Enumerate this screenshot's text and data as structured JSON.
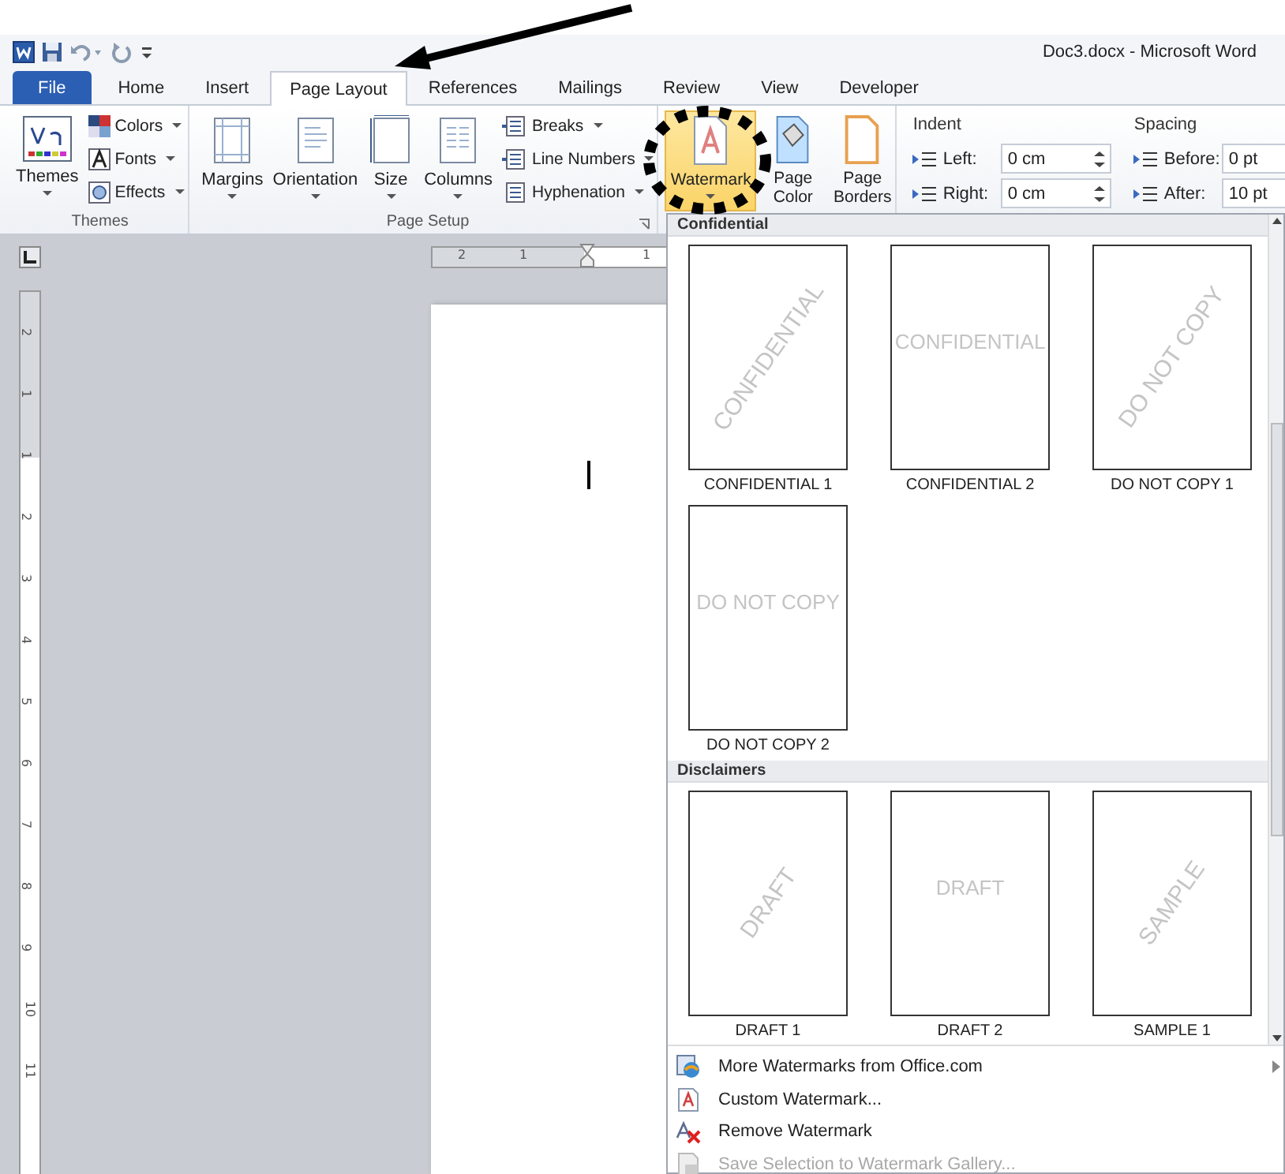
{
  "window": {
    "title": "Doc3.docx - Microsoft Word"
  },
  "tabs": [
    {
      "label": "File",
      "kind": "file",
      "selected": false
    },
    {
      "label": "Home",
      "kind": "tab",
      "selected": false
    },
    {
      "label": "Insert",
      "kind": "tab",
      "selected": false
    },
    {
      "label": "Page Layout",
      "kind": "tab",
      "selected": true
    },
    {
      "label": "References",
      "kind": "tab",
      "selected": false
    },
    {
      "label": "Mailings",
      "kind": "tab",
      "selected": false
    },
    {
      "label": "Review",
      "kind": "tab",
      "selected": false
    },
    {
      "label": "View",
      "kind": "tab",
      "selected": false
    },
    {
      "label": "Developer",
      "kind": "tab",
      "selected": false
    }
  ],
  "ribbon": {
    "themes": {
      "button": "Themes",
      "items": [
        "Colors",
        "Fonts",
        "Effects"
      ],
      "label": "Themes"
    },
    "page_setup": {
      "buttons": [
        "Margins",
        "Orientation",
        "Size",
        "Columns"
      ],
      "items": [
        "Breaks",
        "Line Numbers",
        "Hyphenation"
      ],
      "label": "Page Setup"
    },
    "page_background": [
      {
        "label": "Watermark",
        "kind": "watermark",
        "selected": true
      },
      {
        "label": "Page Color",
        "kind": "color",
        "selected": false
      },
      {
        "label": "Page Borders",
        "kind": "borders",
        "selected": false
      }
    ],
    "paragraph": [
      {
        "title": "Indent",
        "fields": [
          {
            "label": "Left:",
            "value": "0 cm"
          },
          {
            "label": "Right:",
            "value": "0 cm"
          }
        ]
      },
      {
        "title": "Spacing",
        "fields": [
          {
            "label": "Before:",
            "value": "0 pt"
          },
          {
            "label": "After:",
            "value": "10 pt"
          }
        ]
      }
    ]
  },
  "ruler": {
    "horizontal": [
      "2",
      "1",
      "1"
    ],
    "vertical": [
      "2",
      "1",
      "1",
      "2",
      "3",
      "4",
      "5",
      "6",
      "7",
      "8",
      "9",
      "10",
      "11"
    ]
  },
  "gallery": [
    {
      "title": "Confidential",
      "items": [
        {
          "label": "CONFIDENTIAL 1",
          "mark": "CONFIDENTIAL",
          "kind": "diagonal"
        },
        {
          "label": "CONFIDENTIAL 2",
          "mark": "CONFIDENTIAL",
          "kind": "horizontal"
        },
        {
          "label": "DO NOT COPY 1",
          "mark": "DO NOT COPY",
          "kind": "diagonal"
        },
        {
          "label": "DO NOT COPY 2",
          "mark": "DO NOT COPY",
          "kind": "horizontal"
        }
      ]
    },
    {
      "title": "Disclaimers",
      "items": [
        {
          "label": "DRAFT 1",
          "mark": "DRAFT",
          "kind": "diagonal"
        },
        {
          "label": "DRAFT 2",
          "mark": "DRAFT",
          "kind": "horizontal"
        },
        {
          "label": "SAMPLE 1",
          "mark": "SAMPLE",
          "kind": "diagonal"
        }
      ]
    }
  ],
  "menu": [
    {
      "label": "More Watermarks from Office.com",
      "kind": "more",
      "submenu": true,
      "disabled": false
    },
    {
      "label": "Custom Watermark...",
      "kind": "custom",
      "submenu": false,
      "disabled": false
    },
    {
      "label": "Remove Watermark",
      "kind": "remove",
      "submenu": false,
      "disabled": false
    },
    {
      "label": "Save Selection to Watermark Gallery...",
      "kind": "save",
      "submenu": false,
      "disabled": true
    }
  ]
}
